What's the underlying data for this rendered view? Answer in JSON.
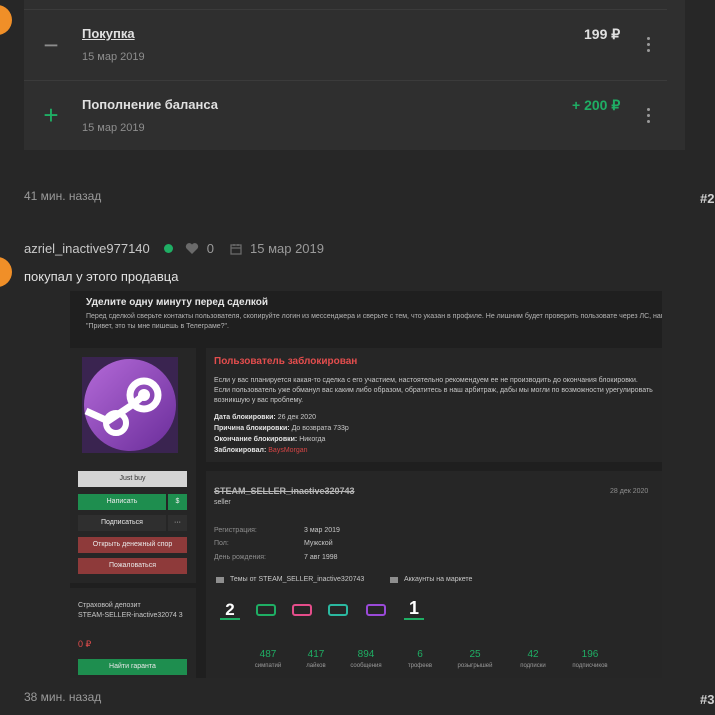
{
  "transactions": [
    {
      "icon": "minus-icon",
      "title": "Покупка",
      "date": "15 мар 2019",
      "amount": "199 ₽",
      "color": "#e0e0e0"
    },
    {
      "icon": "plus-icon",
      "title": "Пополнение баланса",
      "date": "15 мар 2019",
      "amount": "+ 200 ₽",
      "color": "#1fae64"
    }
  ],
  "post1": {
    "time_ago": "41 мин. назад",
    "number": "#2"
  },
  "post2": {
    "author": "azriel_inactive977140",
    "likes": "0",
    "date": "15 мар 2019",
    "text": "покупал у этого продавца",
    "time_ago": "38 мин. назад",
    "number": "#3"
  },
  "embedded": {
    "warning_title": "Уделите одну минуту перед сделкой",
    "warning_text": "Перед сделкой сверьте контакты пользователя, скопируйте логин из мессенджера и сверьте с тем, что указан в профиле. Не лишним будет проверить пользовате через ЛС, написав: \"Привет, это ты мне пишешь в Телеграме?\".",
    "blocked_title": "Пользователь заблокирован",
    "blocked_text": "Если у вас планируется какая-то сделка с его участием, настоятельно рекомендуем ее не производить до окончания блокировки. Если пользователь уже обманул вас каким либо образом, обратитесь в наш арбитраж, дабы мы могли по возможности урегулировать возникшую у вас проблему.",
    "block_date_label": "Дата блокировки:",
    "block_date": "26 дек 2020",
    "block_reason_label": "Причина блокировки:",
    "block_reason": "До возврата 733р",
    "block_end_label": "Окончание блокировки:",
    "block_end": "Никогда",
    "blocked_by_label": "Заблокировал:",
    "blocked_by": "BaysMorgan",
    "badge": "Just buy",
    "btn_write": "Написать",
    "btn_currency": "$",
    "btn_subscribe": "Подписаться",
    "btn_more": "···",
    "btn_dispute": "Открыть денежный спор",
    "btn_complain": "Пожаловаться",
    "deposit_label": "Страховой депозит",
    "deposit_user": "STEAM-SELLER-inactive32074 3",
    "deposit_value": "0 ₽",
    "btn_guarant": "Найти гаранта",
    "username": "STEAM_SELLER_inactive320743",
    "user_date": "28 дек 2020",
    "user_status": "seller",
    "reg_label": "Регистрация:",
    "reg_value": "3 мар 2019",
    "gender_label": "Пол:",
    "gender_value": "Мужской",
    "bday_label": "День рождения:",
    "bday_value": "7 авг 1998",
    "topics_link": "Темы от STEAM_SELLER_inactive320743",
    "market_link": "Аккаунты на маркете",
    "stats": [
      {
        "n": "487",
        "l": "симпатий"
      },
      {
        "n": "417",
        "l": "лайков"
      },
      {
        "n": "894",
        "l": "сообщения"
      },
      {
        "n": "6",
        "l": "трофеев"
      },
      {
        "n": "25",
        "l": "розыгрышей"
      },
      {
        "n": "42",
        "l": "подписки"
      },
      {
        "n": "196",
        "l": "подписчиков"
      }
    ],
    "trophies": [
      {
        "icon": "trophy-2-icon",
        "text": "2"
      },
      {
        "icon": "trophy-tank-icon",
        "text": ""
      },
      {
        "icon": "trophy-cart-pink-icon",
        "text": ""
      },
      {
        "icon": "trophy-cart-teal-icon",
        "text": ""
      },
      {
        "icon": "trophy-cart-purple-icon",
        "text": ""
      },
      {
        "icon": "trophy-1-icon",
        "text": "1"
      }
    ]
  },
  "colors": {
    "accent": "#1fae64",
    "red": "#e34d4d",
    "orange": "#f08f28",
    "button_red": "#8e3a3a"
  }
}
